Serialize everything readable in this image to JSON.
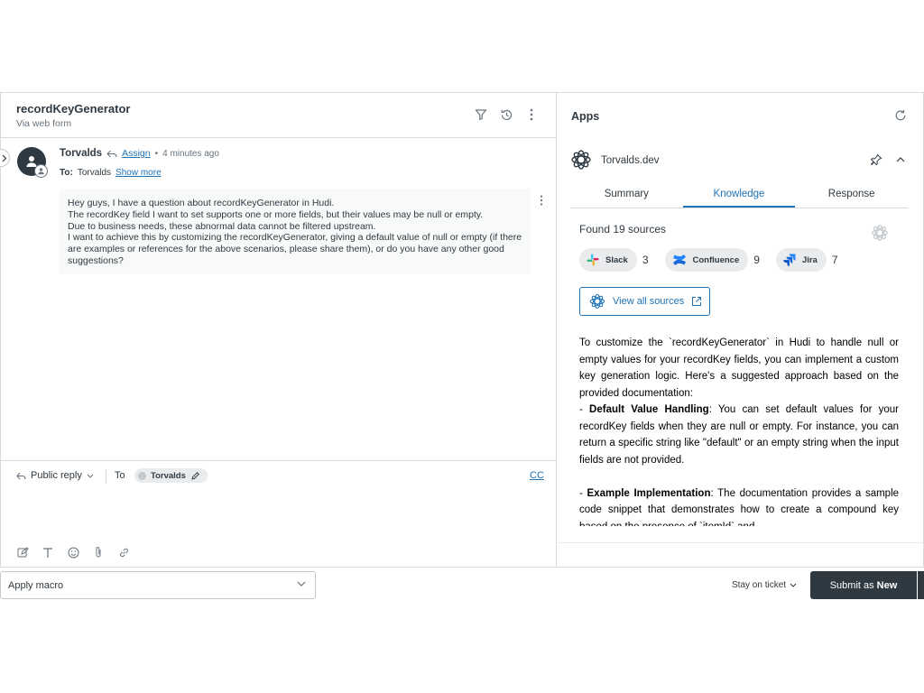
{
  "ticket": {
    "title": "recordKeyGenerator",
    "subtitle": "Via web form"
  },
  "comment": {
    "author": "Torvalds",
    "assign_label": "Assign",
    "separator": "•",
    "time_ago": "4 minutes ago",
    "to_label": "To:",
    "to_name": "Torvalds",
    "show_more": "Show more",
    "lines": [
      "Hey guys, I have a question about recordKeyGenerator in Hudi.",
      "The recordKey field I want to set supports one or more fields, but their values may be null or empty.",
      "Due to business needs, these abnormal data cannot be filtered upstream.",
      "I want to achieve this by customizing the recordKeyGenerator, giving a default value of null or empty (if there are examples or references for the above scenarios, please share them), or do you have any other good suggestions?"
    ]
  },
  "reply": {
    "type_label": "Public reply",
    "to_label": "To",
    "recipient": "Torvalds",
    "cc_label": "CC"
  },
  "footer": {
    "macro_label": "Apply macro",
    "stay_label": "Stay on ticket",
    "submit_prefix": "Submit as",
    "submit_status": "New"
  },
  "apps": {
    "title": "Apps",
    "app_name": "Torvalds.dev",
    "tabs": [
      {
        "label": "Summary"
      },
      {
        "label": "Knowledge"
      },
      {
        "label": "Response"
      }
    ],
    "found_label": "Found 19 sources",
    "sources": [
      {
        "name": "Slack",
        "count": "3"
      },
      {
        "name": "Confluence",
        "count": "9"
      },
      {
        "name": "Jira",
        "count": "7"
      }
    ],
    "view_all_label": "View all sources",
    "answer": {
      "p1": "To customize the `recordKeyGenerator` in Hudi to handle null or empty values for your recordKey fields, you can implement a custom key generation logic. Here's a suggested approach based on the provided documentation:",
      "p2_bold": "Default Value Handling",
      "p2_rest": ": You can set default values for your recordKey fields when they are null or empty. For instance, you can return a specific string like \"default\" or an empty string when the input fields are not provided.",
      "p3_bold": "Example Implementation",
      "p3_rest": ": The documentation provides a sample code snippet that demonstrates how to create a compound key based on the presence of `itemId` and"
    }
  },
  "colors": {
    "link": "#1f73b7",
    "primary_button": "#2f3941",
    "text": "#2f3941",
    "muted": "#68737d"
  }
}
